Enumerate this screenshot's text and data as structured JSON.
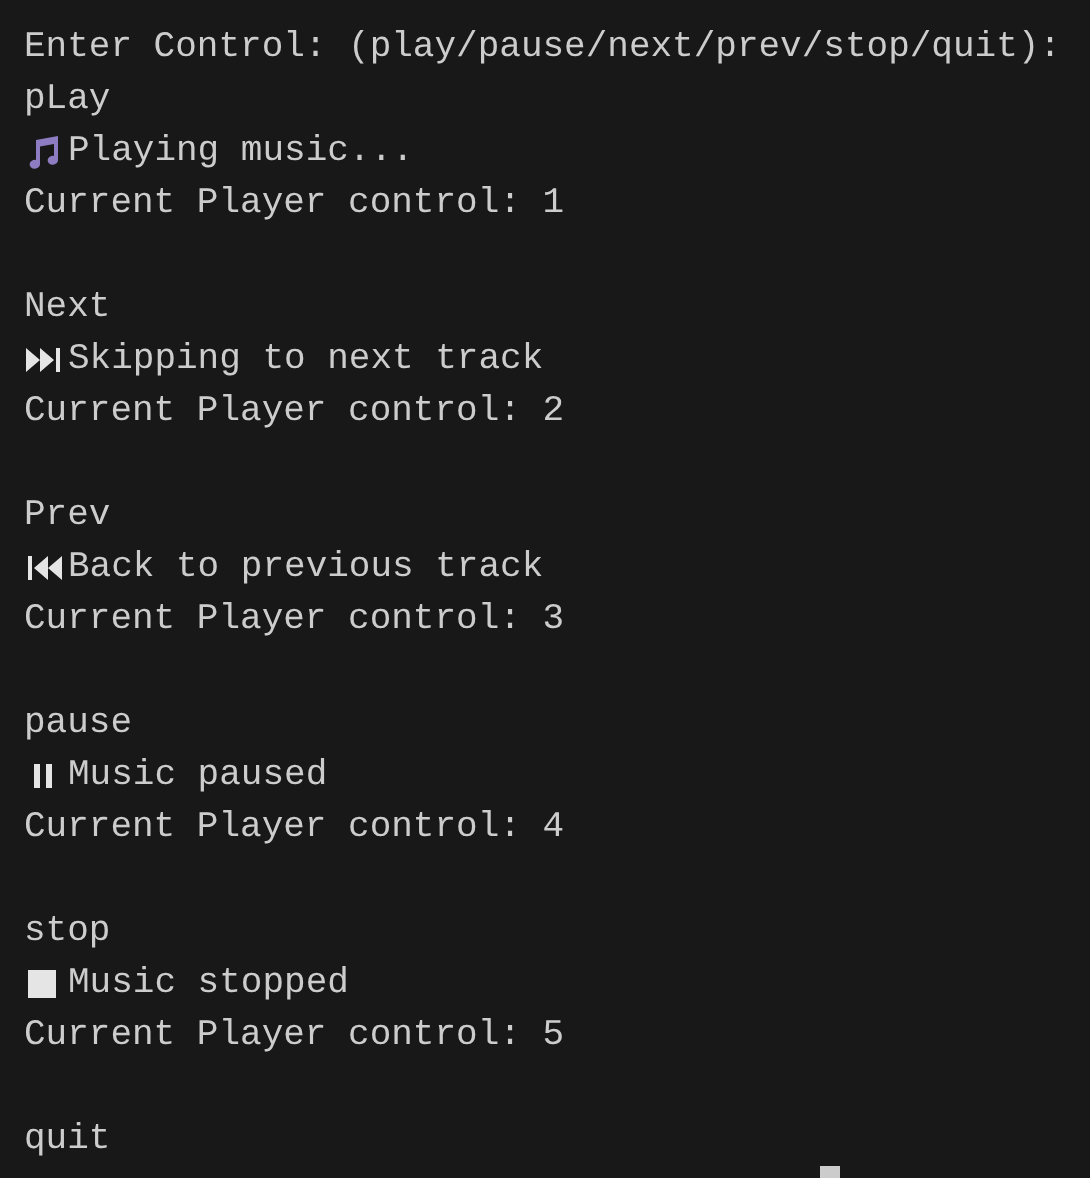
{
  "prompt": "Enter Control: (play/pause/next/prev/stop/quit):",
  "lines": [
    {
      "kind": "text",
      "text": "pLay"
    },
    {
      "kind": "music",
      "text": "Playing music..."
    },
    {
      "kind": "text",
      "text": "Current Player control: 1"
    },
    {
      "kind": "blank"
    },
    {
      "kind": "text",
      "text": "Next"
    },
    {
      "kind": "next",
      "text": "Skipping to next track"
    },
    {
      "kind": "text",
      "text": "Current Player control: 2"
    },
    {
      "kind": "blank"
    },
    {
      "kind": "text",
      "text": "Prev"
    },
    {
      "kind": "prev",
      "text": "Back to previous track"
    },
    {
      "kind": "text",
      "text": "Current Player control: 3"
    },
    {
      "kind": "blank"
    },
    {
      "kind": "text",
      "text": "pause"
    },
    {
      "kind": "pause",
      "text": "Music paused"
    },
    {
      "kind": "text",
      "text": "Current Player control: 4"
    },
    {
      "kind": "blank"
    },
    {
      "kind": "text",
      "text": "stop"
    },
    {
      "kind": "stop",
      "text": "Music stopped"
    },
    {
      "kind": "text",
      "text": "Current Player control: 5"
    },
    {
      "kind": "blank"
    },
    {
      "kind": "text",
      "text": "quit"
    }
  ]
}
